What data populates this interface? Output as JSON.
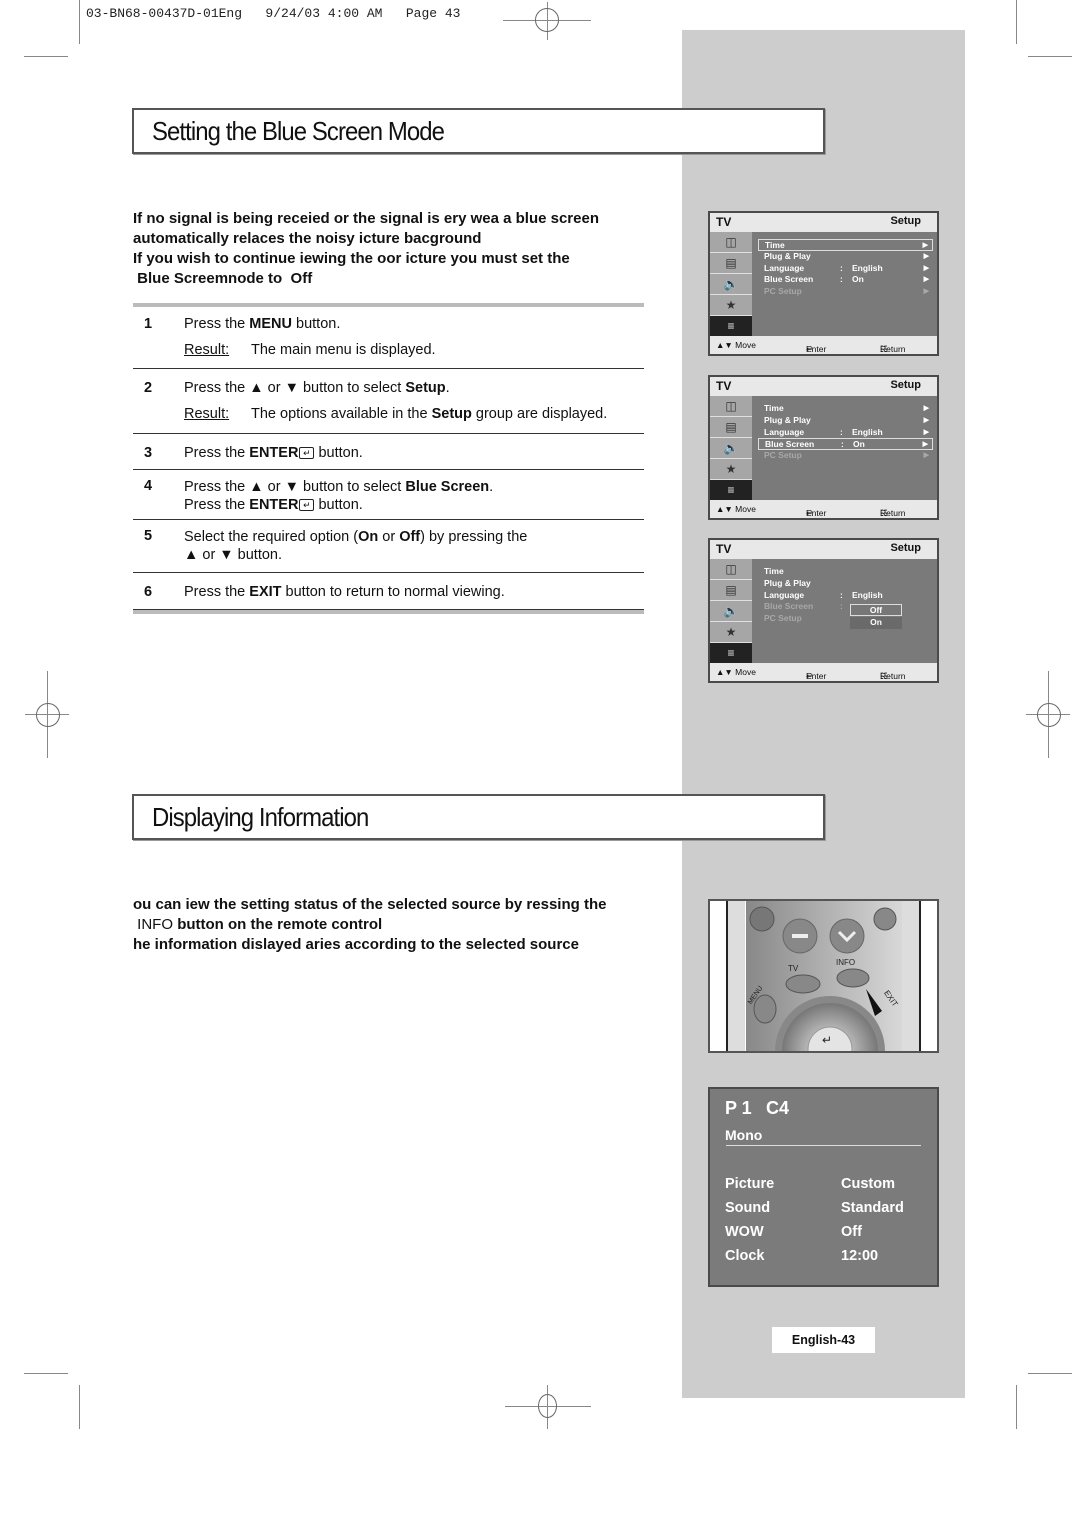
{
  "slug": "03-BN68-00437D-01Eng   9/24/03 4:00 AM   Page 43",
  "section1": {
    "title": "Setting the Blue Screen Mode",
    "intro_lines": [
      "If no signal is being receied or the signal is ery wea a blue screen",
      "automatically relaces the noisy icture bacground",
      "If you wish to continue iewing the oor icture you must set the",
      " Blue Screemnode to  Off"
    ],
    "steps": [
      {
        "num": "1",
        "pre": "Press the ",
        "bold": "MENU",
        "post": " button.",
        "result_label": "Result:",
        "result_pre": "The main menu is displayed.",
        "result_bold": "",
        "result_post": ""
      },
      {
        "num": "2",
        "pre": "Press the ▲ or ▼ button to select ",
        "bold": "Setup",
        "post": ".",
        "result_label": "Result:",
        "result_pre": "The options available in the ",
        "result_bold": "Setup",
        "result_post": " group are displayed."
      },
      {
        "num": "3",
        "pre": "Press the ",
        "bold": "ENTER",
        "post": " button."
      },
      {
        "num": "4",
        "pre": "Press the ▲ or ▼ button to select ",
        "bold": "Blue Screen",
        "post": ".",
        "line2_pre": "Press the ",
        "line2_bold": "ENTER",
        "line2_post": " button."
      },
      {
        "num": "5",
        "pre": "Select the required option (",
        "bold": "On",
        "mid": " or ",
        "bold2": "Off",
        "post": ") by pressing the",
        "line2": "▲ or ▼ button."
      },
      {
        "num": "6",
        "pre": "Press the ",
        "bold": "EXIT",
        "post": " button to return to normal viewing."
      }
    ],
    "enter_glyph": "↵"
  },
  "osd": {
    "tv_label": "TV",
    "header": "Setup",
    "side_icons": [
      "input-icon",
      "picture-icon",
      "sound-icon",
      "channel-icon",
      "setup-icon"
    ],
    "items": [
      {
        "label": "Time",
        "colon": "",
        "value": "",
        "arrow": "▶"
      },
      {
        "label": "Plug & Play",
        "colon": "",
        "value": "",
        "arrow": "▶"
      },
      {
        "label": "Language",
        "colon": ":",
        "value": "English",
        "arrow": "▶"
      },
      {
        "label": "Blue Screen",
        "colon": ":",
        "value": "On",
        "arrow": "▶"
      },
      {
        "label": "PC Setup",
        "colon": "",
        "value": "",
        "arrow": "▶"
      }
    ],
    "footer": {
      "move": "▲▼ Move",
      "enter": "Enter",
      "return": "Return"
    },
    "screens": [
      {
        "highlight": "Time"
      },
      {
        "highlight": "Blue Screen"
      },
      {
        "highlight": "Off",
        "options": [
          "Off",
          "On"
        ]
      }
    ]
  },
  "section2": {
    "title": "Displaying Information",
    "intro_lines": [
      "ou can iew the setting status of the selected source by ressing the",
      "button on the remote control",
      "he information dislayed aries according to the selected source"
    ],
    "info_key": "INFO"
  },
  "remote": {
    "labels": [
      "TV",
      "INFO",
      "MENU",
      "EXIT"
    ]
  },
  "info_display": {
    "program": "P 1",
    "channel": "C4",
    "audio": "Mono",
    "rows": [
      {
        "label": "Picture",
        "value": "Custom"
      },
      {
        "label": "Sound",
        "value": "Standard"
      },
      {
        "label": "WOW",
        "value": "Off"
      },
      {
        "label": "Clock",
        "value": "12:00"
      }
    ]
  },
  "page_number": "English-43"
}
